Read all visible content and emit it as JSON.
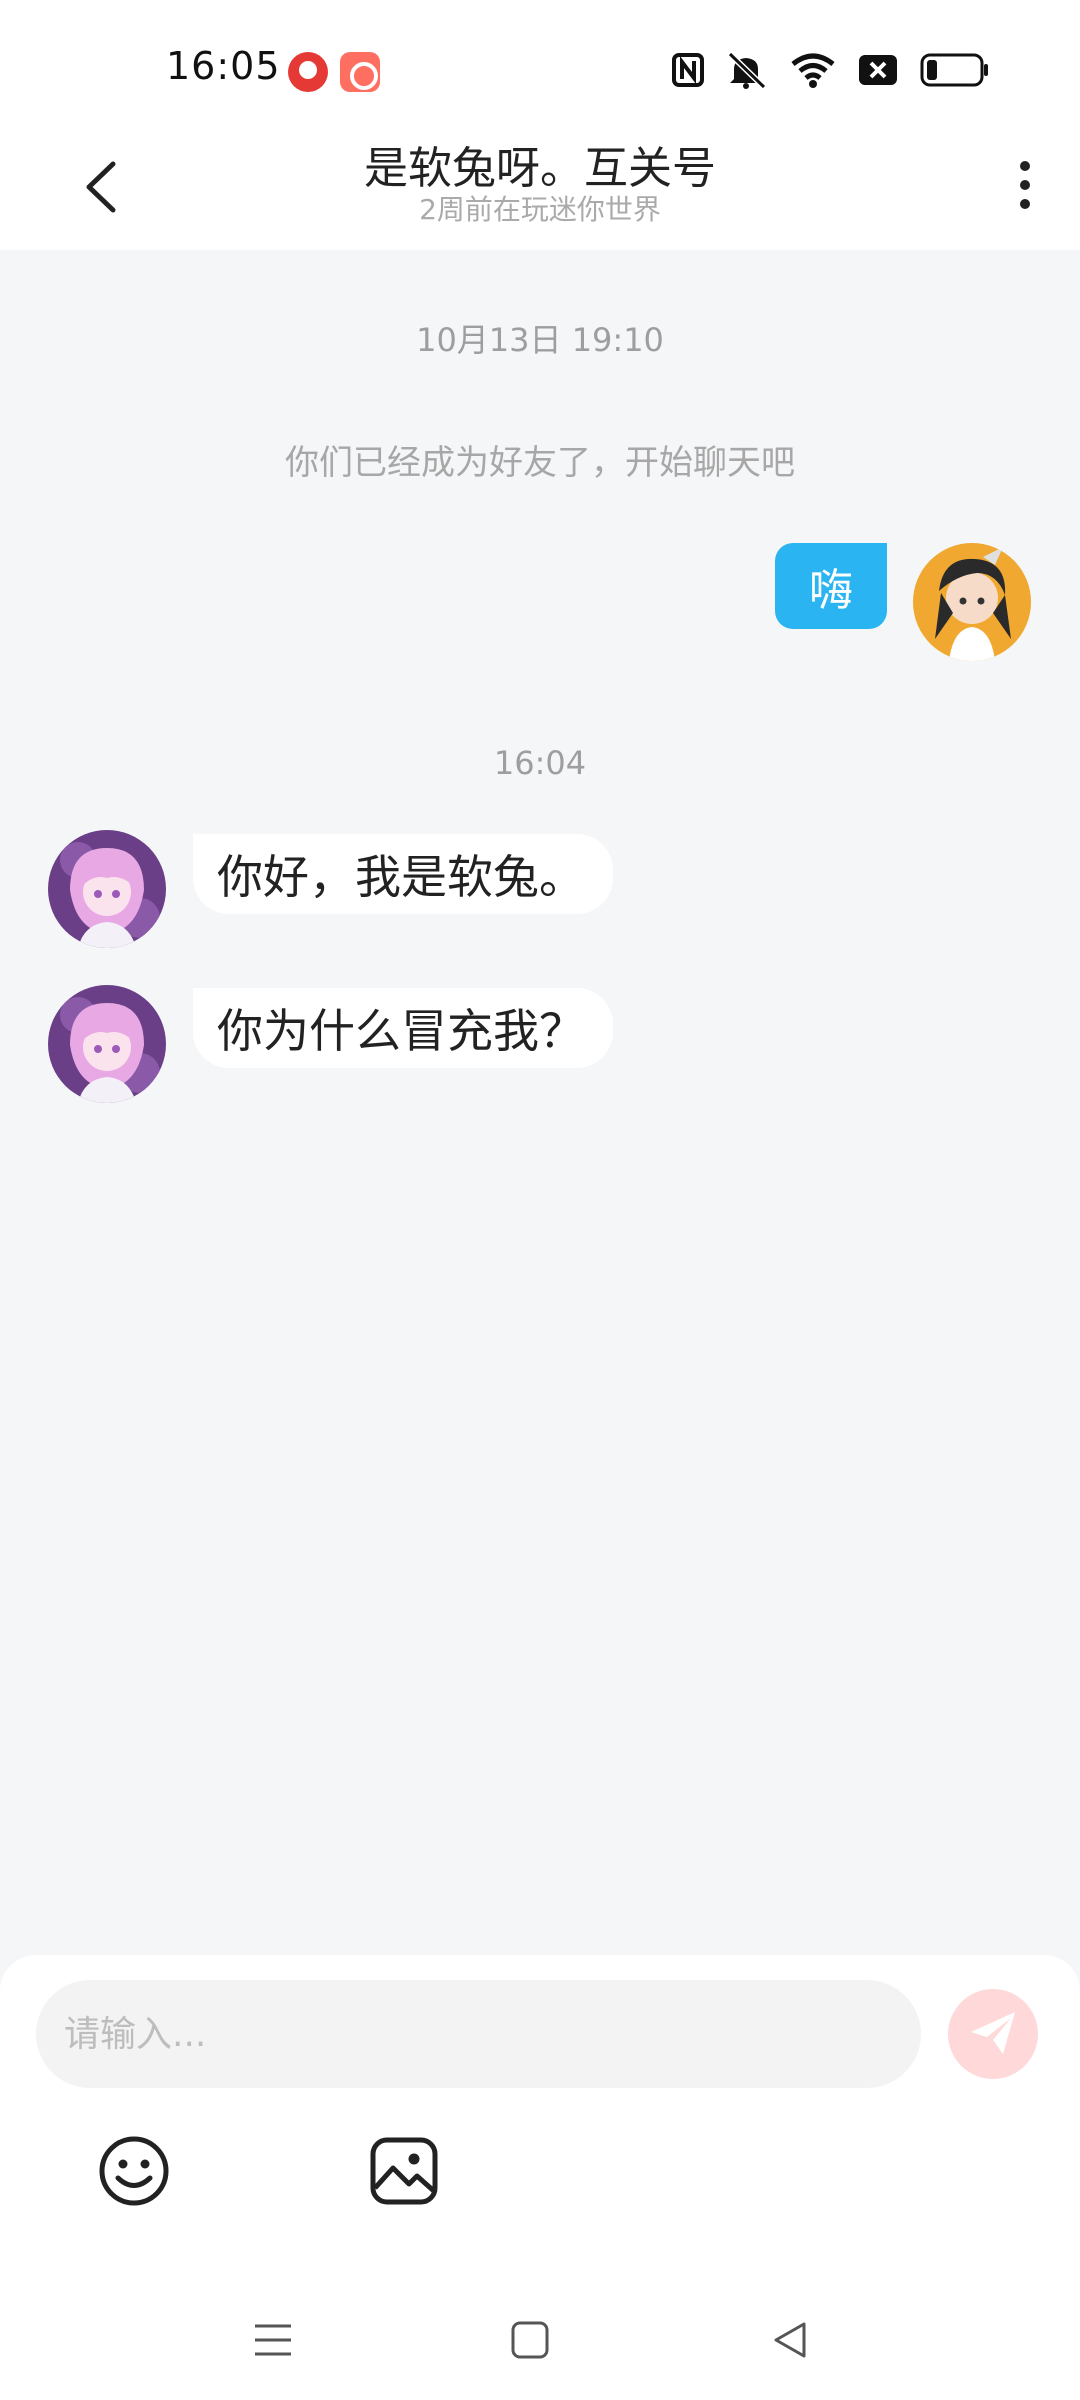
{
  "status_bar": {
    "time": "16:05",
    "icons": [
      "netease-music-icon",
      "kuaishou-icon",
      "nfc-icon",
      "mute-icon",
      "wifi-icon",
      "sim-disabled-icon",
      "battery-icon"
    ],
    "battery_color": "#111111"
  },
  "header": {
    "title": "是软兔呀。互关号",
    "subtitle": "2周前在玩迷你世界"
  },
  "chat": {
    "time_1": "10月13日 19:10",
    "system_message": "你们已经成为好友了，开始聊天吧",
    "time_2": "16:04",
    "messages": [
      {
        "sender": "me",
        "text": "嗨"
      },
      {
        "sender": "them",
        "text": "你好，我是软兔。"
      },
      {
        "sender": "them",
        "text": "你为什么冒充我？"
      }
    ]
  },
  "input": {
    "placeholder": "请输入..."
  },
  "colors": {
    "my_bubble": "#2bb4f2",
    "background": "#f5f6f8",
    "send_button": "#ffd9d9",
    "send_icon": "#ffffff"
  }
}
